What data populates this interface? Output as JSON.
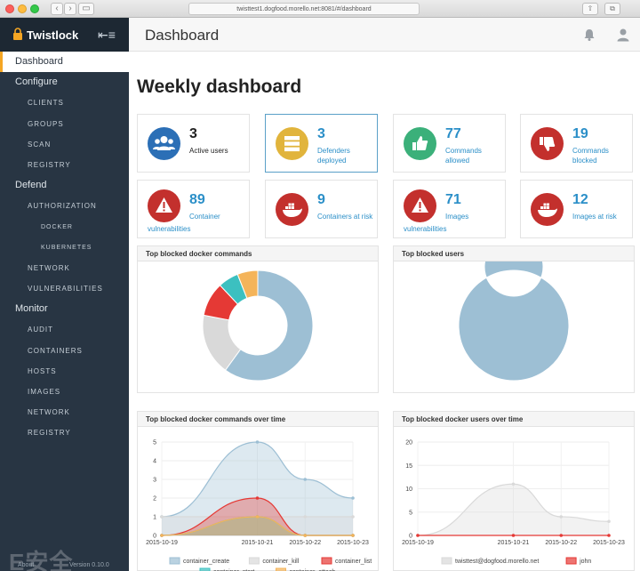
{
  "browser": {
    "url": "twisttest1.dogfood.morello.net:8081/#/dashboard"
  },
  "sidebar": {
    "brand": "Twistlock",
    "items": [
      {
        "label": "Dashboard",
        "level": 0,
        "active": true
      },
      {
        "label": "Configure",
        "level": 0
      },
      {
        "label": "CLIENTS",
        "level": 1
      },
      {
        "label": "GROUPS",
        "level": 1
      },
      {
        "label": "SCAN",
        "level": 1
      },
      {
        "label": "REGISTRY",
        "level": 1
      },
      {
        "label": "Defend",
        "level": 0
      },
      {
        "label": "AUTHORIZATION",
        "level": 1
      },
      {
        "label": "DOCKER",
        "level": 2
      },
      {
        "label": "KUBERNETES",
        "level": 2
      },
      {
        "label": "NETWORK",
        "level": 1
      },
      {
        "label": "VULNERABILITIES",
        "level": 1
      },
      {
        "label": "Monitor",
        "level": 0
      },
      {
        "label": "AUDIT",
        "level": 1
      },
      {
        "label": "CONTAINERS",
        "level": 1
      },
      {
        "label": "HOSTS",
        "level": 1
      },
      {
        "label": "IMAGES",
        "level": 1
      },
      {
        "label": "NETWORK",
        "level": 1
      },
      {
        "label": "REGISTRY",
        "level": 1
      }
    ],
    "about": "About",
    "version": "Version 0.10.0",
    "watermark": "E安全"
  },
  "header": {
    "title": "Dashboard"
  },
  "main": {
    "title": "Weekly dashboard",
    "cards": [
      {
        "value": "3",
        "label": "Active users",
        "color": "#2b6fb6",
        "icon": "users-icon"
      },
      {
        "value": "3",
        "label": "Defenders deployed",
        "color": "#e1b43c",
        "icon": "server-icon"
      },
      {
        "value": "77",
        "label": "Commands allowed",
        "color": "#3bb07a",
        "icon": "thumbs-up-icon"
      },
      {
        "value": "19",
        "label": "Commands blocked",
        "color": "#c3302d",
        "icon": "thumbs-down-icon"
      },
      {
        "value": "89",
        "label1": "Container",
        "label2": "vulnerabilities",
        "color": "#c3302d",
        "icon": "warning-icon"
      },
      {
        "value": "9",
        "label": "Containers at risk",
        "color": "#c3302d",
        "icon": "docker-icon"
      },
      {
        "value": "71",
        "label1": "Images",
        "label2": "vulnerabilities",
        "color": "#c3302d",
        "icon": "warning-icon"
      },
      {
        "value": "12",
        "label": "Images at risk",
        "color": "#c3302d",
        "icon": "docker-icon"
      }
    ],
    "panels": {
      "blocked_commands": "Top blocked docker commands",
      "blocked_users": "Top blocked users",
      "commands_over_time": "Top blocked docker commands over time",
      "users_over_time": "Top blocked docker users over time"
    }
  },
  "chart_data": [
    {
      "type": "pie",
      "title": "Top blocked docker commands",
      "categories": [
        "container_create",
        "container_kill",
        "container_list",
        "container_start",
        "container_attach"
      ],
      "values": [
        60,
        18,
        10,
        6,
        6
      ],
      "colors": [
        "#9dbfd4",
        "#d9d9d9",
        "#e53935",
        "#3cc0c0",
        "#f4b45a"
      ]
    },
    {
      "type": "pie",
      "title": "Top blocked users",
      "categories": [
        "twisttest@dogfood.morello.net"
      ],
      "values": [
        100
      ],
      "colors": [
        "#9dbfd4"
      ]
    },
    {
      "type": "area",
      "title": "Top blocked docker commands over time",
      "x": [
        "2015-10-19",
        "2015-10-21",
        "2015-10-22",
        "2015-10-23"
      ],
      "yticks": [
        0,
        1,
        2,
        3,
        4,
        5
      ],
      "ylim": [
        0,
        5
      ],
      "series": [
        {
          "name": "container_create",
          "color": "#9dbfd4",
          "x": [
            0,
            2,
            3,
            4
          ],
          "values": [
            1,
            5,
            3,
            2
          ]
        },
        {
          "name": "container_kill",
          "color": "#d9d9d9",
          "x": [
            0,
            2,
            3,
            4
          ],
          "values": [
            1,
            1,
            1,
            1
          ]
        },
        {
          "name": "container_list",
          "color": "#e53935",
          "x": [
            0,
            2,
            3,
            4
          ],
          "values": [
            0,
            2,
            0,
            0
          ]
        },
        {
          "name": "container_start",
          "color": "#3cc0c0",
          "x": [
            0,
            2,
            3,
            4
          ],
          "values": [
            0,
            1,
            0,
            0
          ]
        },
        {
          "name": "container_attach",
          "color": "#f4b45a",
          "x": [
            0,
            2,
            3,
            4
          ],
          "values": [
            0,
            1,
            0,
            0
          ]
        }
      ]
    },
    {
      "type": "area",
      "title": "Top blocked docker users over time",
      "x": [
        "2015-10-19",
        "2015-10-21",
        "2015-10-22",
        "2015-10-23"
      ],
      "yticks": [
        0,
        5,
        10,
        15,
        20
      ],
      "ylim": [
        0,
        20
      ],
      "series": [
        {
          "name": "twisttest@dogfood.morello.net",
          "color": "#d9d9d9",
          "x": [
            0,
            2,
            3,
            4
          ],
          "values": [
            0,
            11,
            4,
            3
          ]
        },
        {
          "name": "john",
          "color": "#e53935",
          "x": [
            0,
            2,
            3,
            4
          ],
          "values": [
            0,
            0,
            0,
            0
          ]
        }
      ]
    }
  ]
}
